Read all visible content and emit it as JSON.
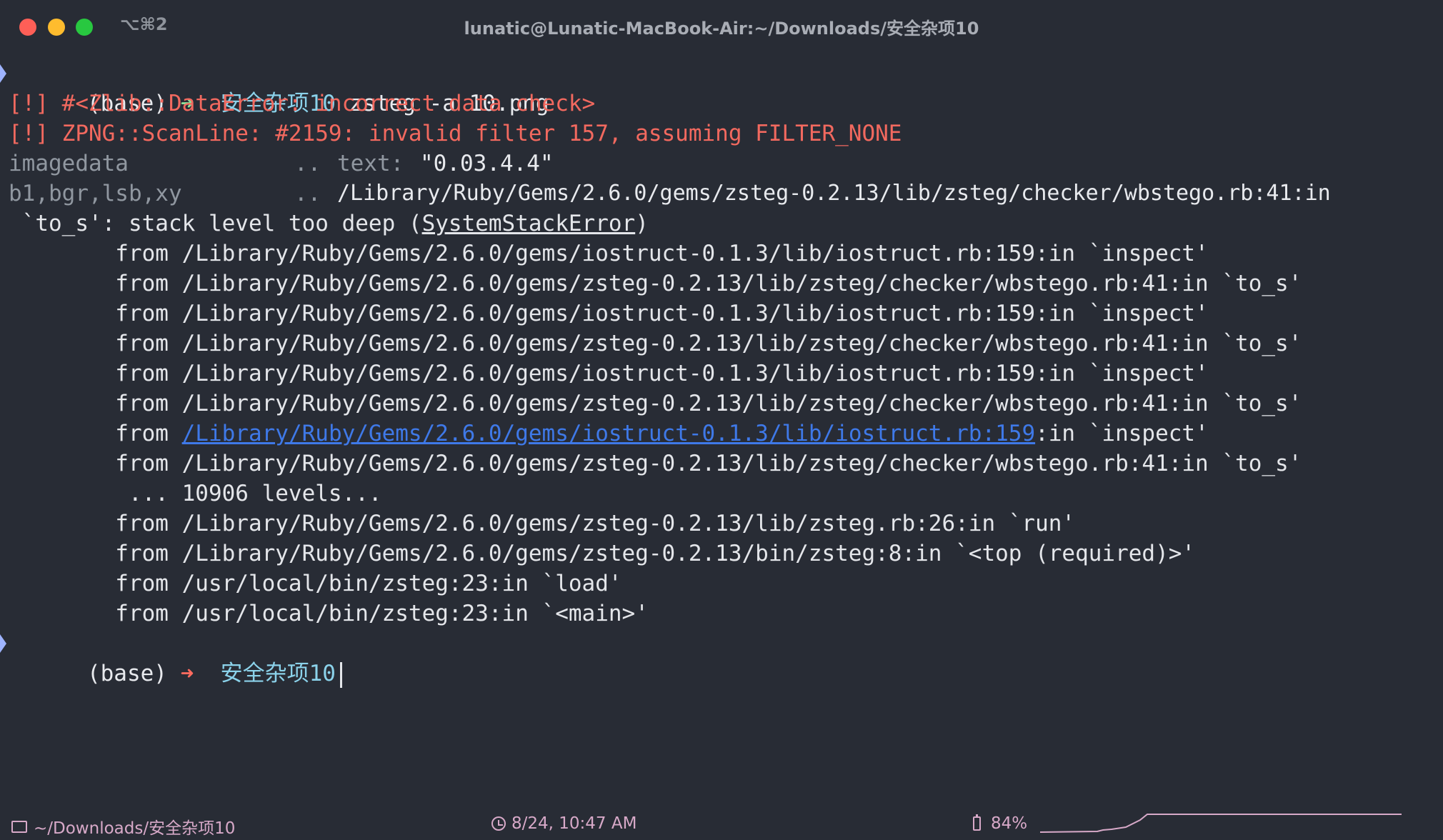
{
  "window": {
    "shortcut": "⌥⌘2",
    "title": "lunatic@Lunatic-MacBook-Air:~/Downloads/安全杂项10"
  },
  "terminal": {
    "prompt1": {
      "env": "(base)",
      "arrow": "➜",
      "dir": "安全杂项10",
      "command": "zsteg -a 10.png"
    },
    "err1": "[!] #<Zlib::DataError: incorrect data check>",
    "err2": "[!] ZPNG::ScanLine: #2159: invalid filter 157, assuming FILTER_NONE",
    "row_imagedata": {
      "name": "imagedata",
      "dots": "..",
      "label": "text:",
      "value": "\"0.03.4.4\""
    },
    "row_b1": {
      "name": "b1,bgr,lsb,xy",
      "dots": "..",
      "value": "/Library/Ruby/Gems/2.6.0/gems/zsteg-0.2.13/lib/zsteg/checker/wbstego.rb:41:in"
    },
    "exception": {
      "prefix": " `to_s': stack level too deep (",
      "class": "SystemStackError",
      "suffix": ")"
    },
    "trace": [
      "        from /Library/Ruby/Gems/2.6.0/gems/iostruct-0.1.3/lib/iostruct.rb:159:in `inspect'",
      "        from /Library/Ruby/Gems/2.6.0/gems/zsteg-0.2.13/lib/zsteg/checker/wbstego.rb:41:in `to_s'",
      "        from /Library/Ruby/Gems/2.6.0/gems/iostruct-0.1.3/lib/iostruct.rb:159:in `inspect'",
      "        from /Library/Ruby/Gems/2.6.0/gems/zsteg-0.2.13/lib/zsteg/checker/wbstego.rb:41:in `to_s'",
      "        from /Library/Ruby/Gems/2.6.0/gems/iostruct-0.1.3/lib/iostruct.rb:159:in `inspect'",
      "        from /Library/Ruby/Gems/2.6.0/gems/zsteg-0.2.13/lib/zsteg/checker/wbstego.rb:41:in `to_s'"
    ],
    "link_line": {
      "prefix": "        from ",
      "link": "/Library/Ruby/Gems/2.6.0/gems/iostruct-0.1.3/lib/iostruct.rb:159",
      "suffix": ":in `inspect'"
    },
    "trace2": [
      "        from /Library/Ruby/Gems/2.6.0/gems/zsteg-0.2.13/lib/zsteg/checker/wbstego.rb:41:in `to_s'",
      "         ... 10906 levels...",
      "        from /Library/Ruby/Gems/2.6.0/gems/zsteg-0.2.13/lib/zsteg.rb:26:in `run'",
      "        from /Library/Ruby/Gems/2.6.0/gems/zsteg-0.2.13/bin/zsteg:8:in `<top (required)>'",
      "        from /usr/local/bin/zsteg:23:in `load'",
      "        from /usr/local/bin/zsteg:23:in `<main>'"
    ],
    "prompt2": {
      "env": "(base)",
      "arrow": "➜",
      "dir": "安全杂项10"
    }
  },
  "statusbar": {
    "folder_icon": "folder-icon",
    "path": "~/Downloads/安全杂项10",
    "clock_icon": "clock-icon",
    "datetime": "8/24, 10:47 AM",
    "battery_icon": "battery-icon",
    "battery": "84%"
  }
}
